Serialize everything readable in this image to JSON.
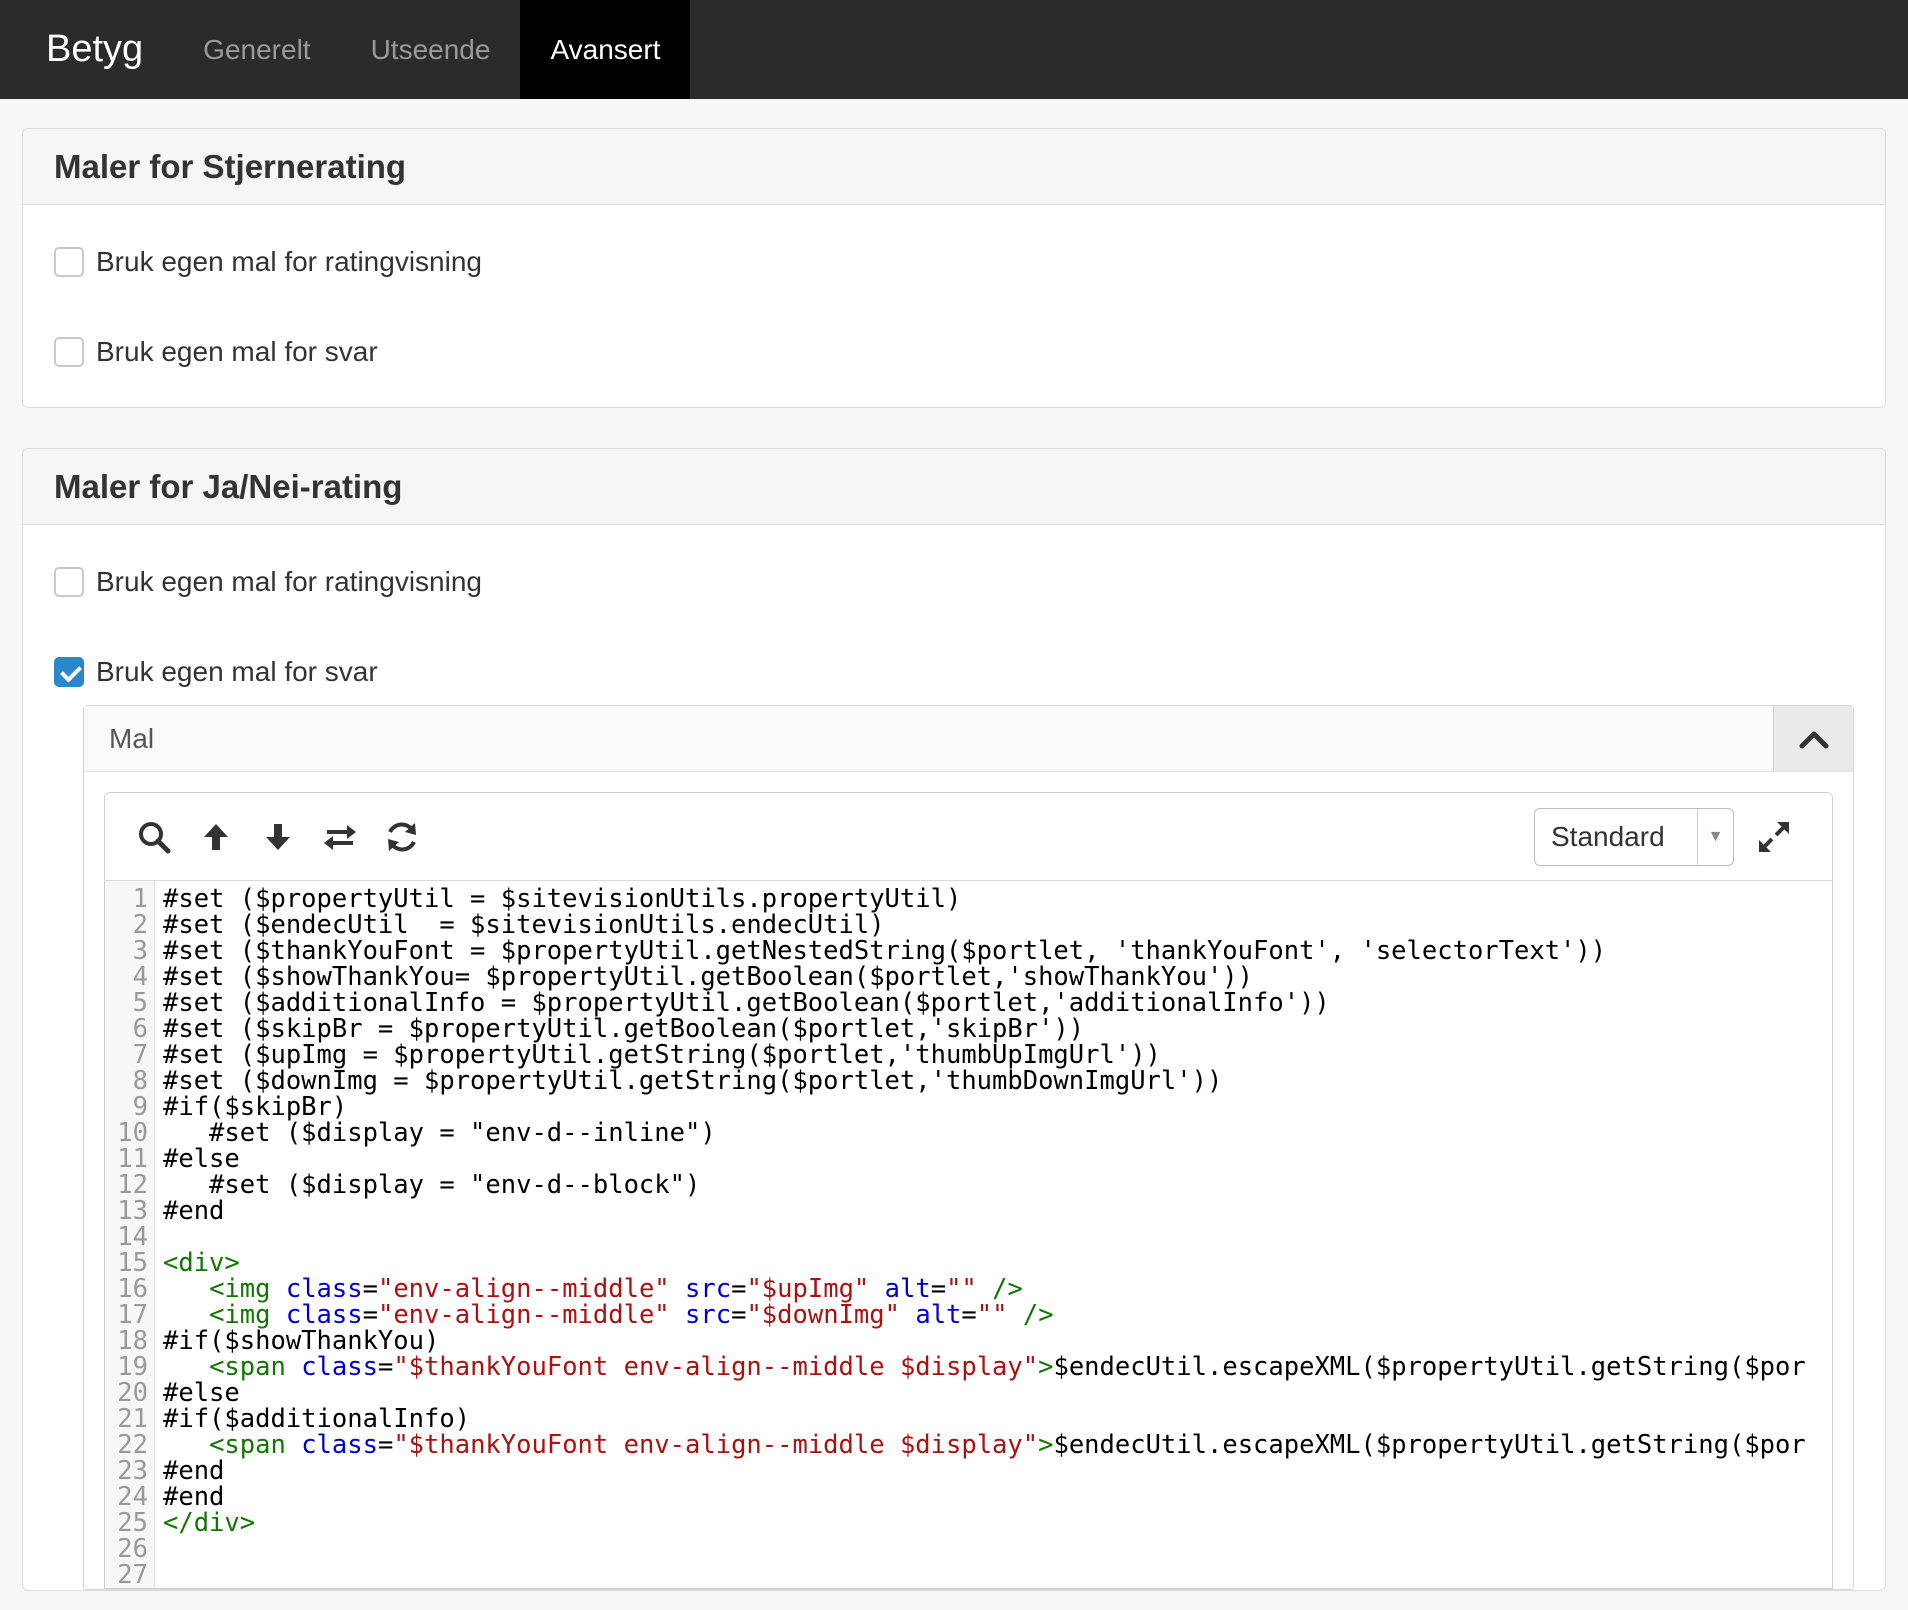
{
  "topbar": {
    "brand": "Betyg",
    "tabs": [
      {
        "label": "Generelt"
      },
      {
        "label": "Utseende"
      },
      {
        "label": "Avansert"
      }
    ]
  },
  "panels": [
    {
      "title": "Maler for Stjernerating",
      "options": [
        {
          "label": "Bruk egen mal for ratingvisning",
          "checked": false
        },
        {
          "label": "Bruk egen mal for svar",
          "checked": false
        }
      ]
    },
    {
      "title": "Maler for Ja/Nei-rating",
      "options": [
        {
          "label": "Bruk egen mal for ratingvisning",
          "checked": false
        },
        {
          "label": "Bruk egen mal for svar",
          "checked": true
        }
      ]
    }
  ],
  "template_box": {
    "title": "Mal",
    "toolbar": {
      "icons": [
        "search-icon",
        "arrow-up-icon",
        "arrow-down-icon",
        "swap-icon",
        "refresh-icon",
        "expand-icon"
      ],
      "mode_select": "Standard"
    },
    "line_numbers": [
      "1",
      "2",
      "3",
      "4",
      "5",
      "6",
      "7",
      "8",
      "9",
      "10",
      "11",
      "12",
      "13",
      "14",
      "15",
      "16",
      "17",
      "18",
      "19",
      "20",
      "21",
      "22",
      "23",
      "24",
      "25",
      "26",
      "27"
    ],
    "code_lines": [
      "#set ($propertyUtil = $sitevisionUtils.propertyUtil)",
      "#set ($endecUtil  = $sitevisionUtils.endecUtil)",
      "#set ($thankYouFont = $propertyUtil.getNestedString($portlet, 'thankYouFont', 'selectorText'))",
      "#set ($showThankYou= $propertyUtil.getBoolean($portlet,'showThankYou'))",
      "#set ($additionalInfo = $propertyUtil.getBoolean($portlet,'additionalInfo'))",
      "#set ($skipBr = $propertyUtil.getBoolean($portlet,'skipBr'))",
      "#set ($upImg = $propertyUtil.getString($portlet,'thumbUpImgUrl'))",
      "#set ($downImg = $propertyUtil.getString($portlet,'thumbDownImgUrl'))",
      "#if($skipBr)",
      "   #set ($display = \"env-d--inline\")",
      "#else",
      "   #set ($display = \"env-d--block\")",
      "#end",
      "",
      "<div>",
      "   <img class=\"env-align--middle\" src=\"$upImg\" alt=\"\" />",
      "   <img class=\"env-align--middle\" src=\"$downImg\" alt=\"\" />",
      "#if($showThankYou)",
      "   <span class=\"$thankYouFont env-align--middle $display\">$endecUtil.escapeXML($propertyUtil.getString($por",
      "#else",
      "#if($additionalInfo)",
      "   <span class=\"$thankYouFont env-align--middle $display\">$endecUtil.escapeXML($propertyUtil.getString($por",
      "#end",
      "#end",
      "</div>",
      "",
      ""
    ]
  }
}
